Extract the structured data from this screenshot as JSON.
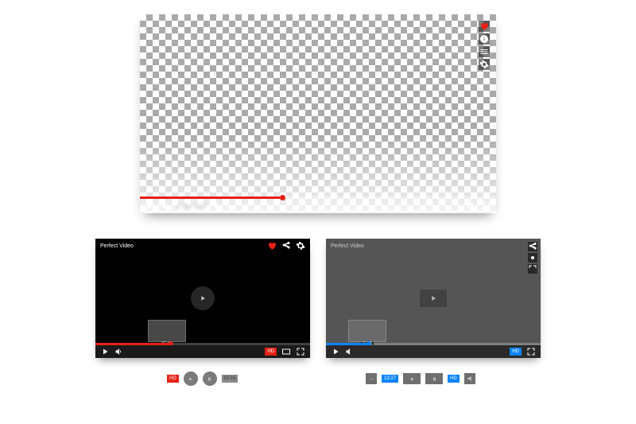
{
  "main_player": {
    "current_time": "1:35",
    "duration": "8:12",
    "time_display": "1:35 / 8:12"
  },
  "dark_player": {
    "title": "Perfect Video",
    "preview_time": "15:14",
    "hd_label": "HD"
  },
  "gray_player": {
    "title": "Perfect Video",
    "preview_time": "3:14",
    "hd_label": "HD"
  },
  "buttons_row1": {
    "hd": "HD",
    "time": "10:16"
  },
  "buttons_row2": {
    "time": "13:27",
    "hd": "HD"
  }
}
